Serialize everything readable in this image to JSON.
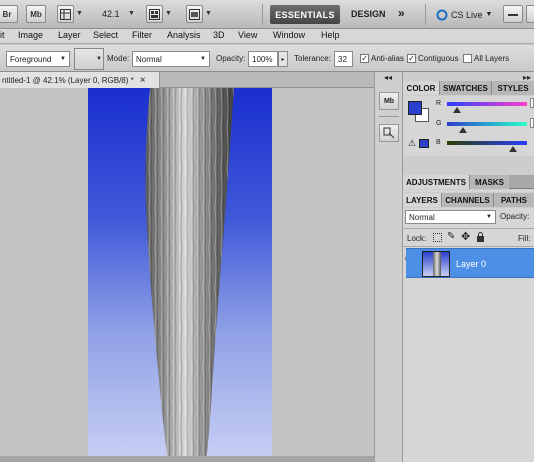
{
  "appbar": {
    "br_label": "Br",
    "mb_label": "Mb",
    "zoom_value": "42.1",
    "essentials_label": "ESSENTIALS",
    "design_label": "DESIGN",
    "more_label": "»",
    "cslive_label": "CS Live"
  },
  "menus": [
    "it",
    "Image",
    "Layer",
    "Select",
    "Filter",
    "Analysis",
    "3D",
    "View",
    "Window",
    "Help"
  ],
  "options": {
    "tool_preset": "Foreground",
    "mode_label": "Mode:",
    "mode_value": "Normal",
    "opacity_label": "Opacity:",
    "opacity_value": "100%",
    "tolerance_label": "Tolerance:",
    "tolerance_value": "32",
    "antialias_label": "Anti-alias",
    "contiguous_label": "Contiguous",
    "alllayers_label": "All Layers",
    "antialias_checked": true,
    "contiguous_checked": true,
    "alllayers_checked": false
  },
  "document": {
    "tab_title": "ntitled-1 @ 42.1% (Layer 0, RGB/8) *",
    "close_label": "×"
  },
  "toolstrip": {
    "mb_label": "Mb"
  },
  "color_panel": {
    "tabs": [
      "COLOR",
      "SWATCHES",
      "STYLES"
    ],
    "channels": [
      "R",
      "G",
      "B"
    ],
    "foreground": "#2a3fcc",
    "background": "#ffffff"
  },
  "adjustments_panel": {
    "tabs": [
      "ADJUSTMENTS",
      "MASKS"
    ]
  },
  "layers_panel": {
    "tabs": [
      "LAYERS",
      "CHANNELS",
      "PATHS"
    ],
    "blend_mode": "Normal",
    "opacity_label": "Opacity:",
    "lock_label": "Lock:",
    "fill_label": "Fill:",
    "layer_name": "Layer 0",
    "selected_color": "#4e8fe6"
  }
}
